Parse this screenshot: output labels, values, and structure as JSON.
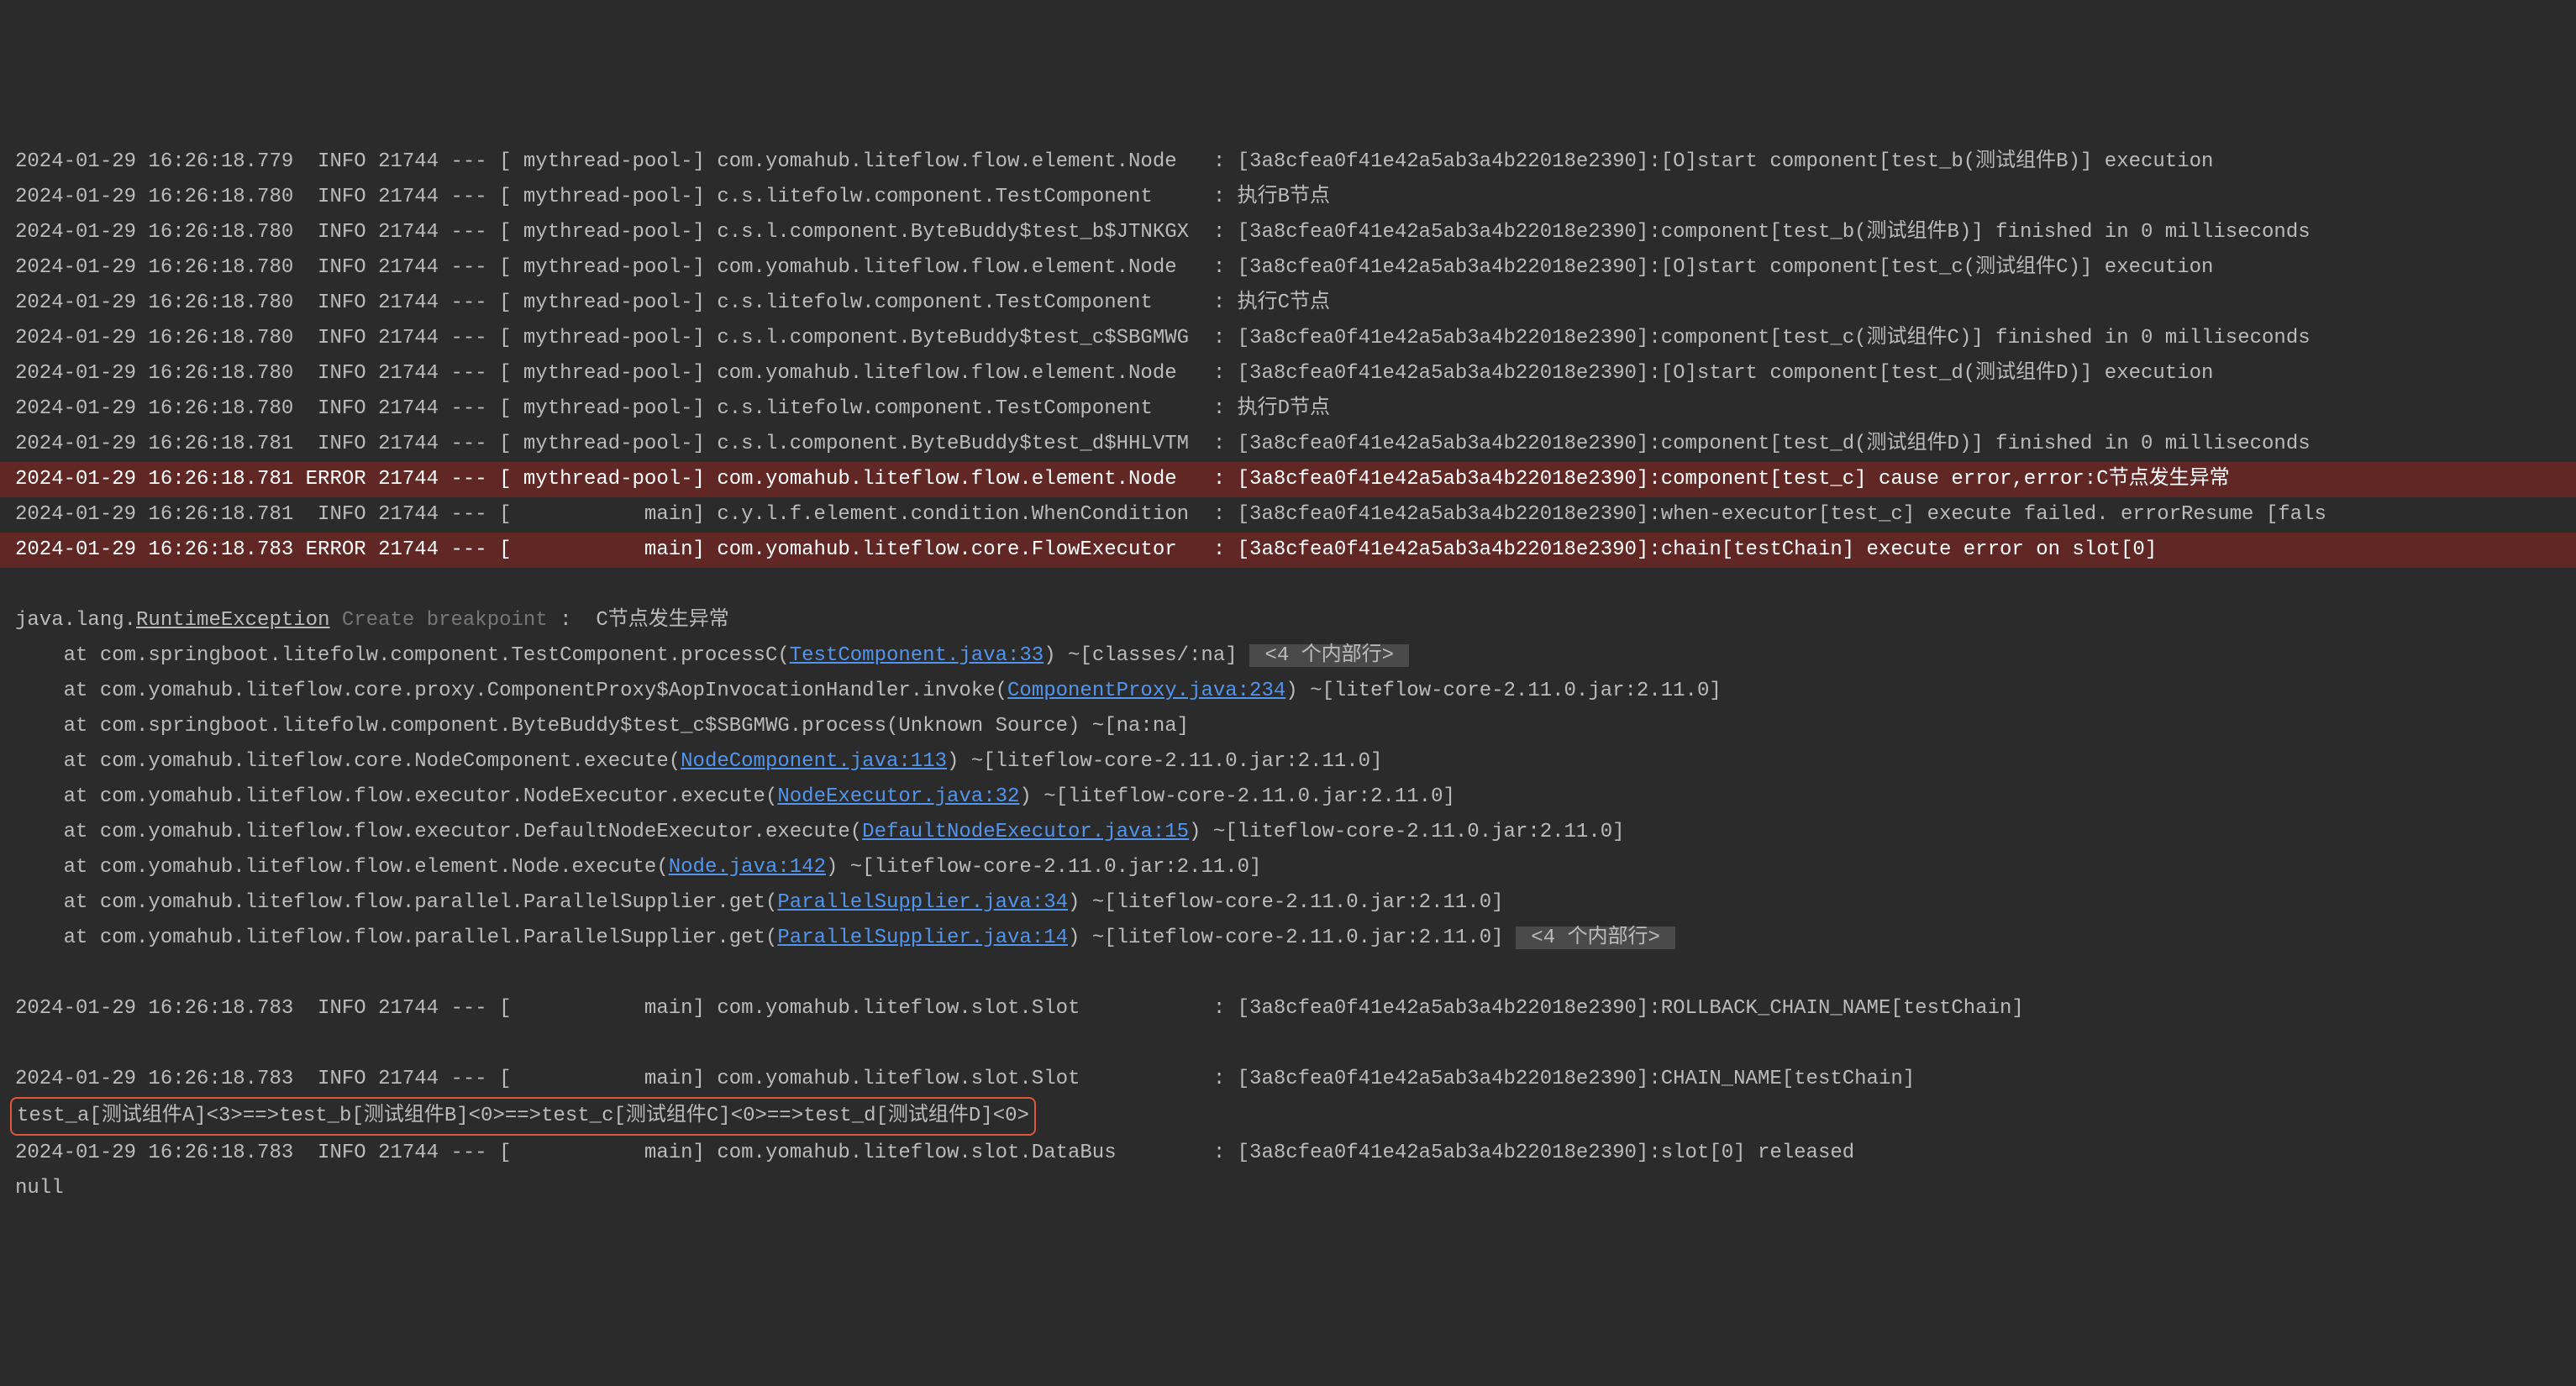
{
  "logLines": [
    {
      "type": "normal",
      "text": "2024-01-29 16:26:18.779  INFO 21744 --- [ mythread-pool-] com.yomahub.liteflow.flow.element.Node   : [3a8cfea0f41e42a5ab3a4b22018e2390]:[O]start component[test_b(测试组件B)] execution"
    },
    {
      "type": "normal",
      "text": "2024-01-29 16:26:18.780  INFO 21744 --- [ mythread-pool-] c.s.litefolw.component.TestComponent     : 执行B节点"
    },
    {
      "type": "normal",
      "text": "2024-01-29 16:26:18.780  INFO 21744 --- [ mythread-pool-] c.s.l.component.ByteBuddy$test_b$JTNKGX  : [3a8cfea0f41e42a5ab3a4b22018e2390]:component[test_b(测试组件B)] finished in 0 milliseconds"
    },
    {
      "type": "normal",
      "text": "2024-01-29 16:26:18.780  INFO 21744 --- [ mythread-pool-] com.yomahub.liteflow.flow.element.Node   : [3a8cfea0f41e42a5ab3a4b22018e2390]:[O]start component[test_c(测试组件C)] execution"
    },
    {
      "type": "normal",
      "text": "2024-01-29 16:26:18.780  INFO 21744 --- [ mythread-pool-] c.s.litefolw.component.TestComponent     : 执行C节点"
    },
    {
      "type": "normal",
      "text": "2024-01-29 16:26:18.780  INFO 21744 --- [ mythread-pool-] c.s.l.component.ByteBuddy$test_c$SBGMWG  : [3a8cfea0f41e42a5ab3a4b22018e2390]:component[test_c(测试组件C)] finished in 0 milliseconds"
    },
    {
      "type": "normal",
      "text": "2024-01-29 16:26:18.780  INFO 21744 --- [ mythread-pool-] com.yomahub.liteflow.flow.element.Node   : [3a8cfea0f41e42a5ab3a4b22018e2390]:[O]start component[test_d(测试组件D)] execution"
    },
    {
      "type": "normal",
      "text": "2024-01-29 16:26:18.780  INFO 21744 --- [ mythread-pool-] c.s.litefolw.component.TestComponent     : 执行D节点"
    },
    {
      "type": "normal",
      "text": "2024-01-29 16:26:18.781  INFO 21744 --- [ mythread-pool-] c.s.l.component.ByteBuddy$test_d$HHLVTM  : [3a8cfea0f41e42a5ab3a4b22018e2390]:component[test_d(测试组件D)] finished in 0 milliseconds"
    },
    {
      "type": "error",
      "text": "2024-01-29 16:26:18.781 ERROR 21744 --- [ mythread-pool-] com.yomahub.liteflow.flow.element.Node   : [3a8cfea0f41e42a5ab3a4b22018e2390]:component[test_c] cause error,error:C节点发生异常"
    },
    {
      "type": "normal",
      "text": "2024-01-29 16:26:18.781  INFO 21744 --- [           main] c.y.l.f.element.condition.WhenCondition  : [3a8cfea0f41e42a5ab3a4b22018e2390]:when-executor[test_c] execute failed. errorResume [fals"
    },
    {
      "type": "error",
      "text": "2024-01-29 16:26:18.783 ERROR 21744 --- [           main] com.yomahub.liteflow.core.FlowExecutor   : [3a8cfea0f41e42a5ab3a4b22018e2390]:chain[testChain] execute error on slot[0]"
    }
  ],
  "exception": {
    "prefix": "java.lang.",
    "type": "RuntimeException",
    "breakpoint": "Create breakpoint",
    "sep": " :  ",
    "message": "C节点发生异常"
  },
  "stack": [
    {
      "pre": "    at com.springboot.litefolw.component.TestComponent.processC(",
      "link": "TestComponent.java:33",
      "post": ") ~[classes/:na]",
      "badge": "<4 个内部行>"
    },
    {
      "pre": "    at com.yomahub.liteflow.core.proxy.ComponentProxy$AopInvocationHandler.invoke(",
      "link": "ComponentProxy.java:234",
      "post": ") ~[liteflow-core-2.11.0.jar:2.11.0]"
    },
    {
      "pre": "    at com.springboot.litefolw.component.ByteBuddy$test_c$SBGMWG.process(Unknown Source) ~[na:na]"
    },
    {
      "pre": "    at com.yomahub.liteflow.core.NodeComponent.execute(",
      "link": "NodeComponent.java:113",
      "post": ") ~[liteflow-core-2.11.0.jar:2.11.0]"
    },
    {
      "pre": "    at com.yomahub.liteflow.flow.executor.NodeExecutor.execute(",
      "link": "NodeExecutor.java:32",
      "post": ") ~[liteflow-core-2.11.0.jar:2.11.0]"
    },
    {
      "pre": "    at com.yomahub.liteflow.flow.executor.DefaultNodeExecutor.execute(",
      "link": "DefaultNodeExecutor.java:15",
      "post": ") ~[liteflow-core-2.11.0.jar:2.11.0]"
    },
    {
      "pre": "    at com.yomahub.liteflow.flow.element.Node.execute(",
      "link": "Node.java:142",
      "post": ") ~[liteflow-core-2.11.0.jar:2.11.0]"
    },
    {
      "pre": "    at com.yomahub.liteflow.flow.parallel.ParallelSupplier.get(",
      "link": "ParallelSupplier.java:34",
      "post": ") ~[liteflow-core-2.11.0.jar:2.11.0]"
    },
    {
      "pre": "    at com.yomahub.liteflow.flow.parallel.ParallelSupplier.get(",
      "link": "ParallelSupplier.java:14",
      "post": ") ~[liteflow-core-2.11.0.jar:2.11.0]",
      "badge": "<4 个内部行>"
    }
  ],
  "tailLines": [
    {
      "type": "normal",
      "text": "2024-01-29 16:26:18.783  INFO 21744 --- [           main] com.yomahub.liteflow.slot.Slot           : [3a8cfea0f41e42a5ab3a4b22018e2390]:ROLLBACK_CHAIN_NAME[testChain]"
    }
  ],
  "chainLog": {
    "header": "2024-01-29 16:26:18.783  INFO 21744 --- [           main] com.yomahub.liteflow.slot.Slot           : [3a8cfea0f41e42a5ab3a4b22018e2390]:CHAIN_NAME[testChain]",
    "chain": "test_a[测试组件A]<3>==>test_b[测试组件B]<0>==>test_c[测试组件C]<0>==>test_d[测试组件D]<0>"
  },
  "afterChain": [
    {
      "type": "normal",
      "text": "2024-01-29 16:26:18.783  INFO 21744 --- [           main] com.yomahub.liteflow.slot.DataBus        : [3a8cfea0f41e42a5ab3a4b22018e2390]:slot[0] released"
    },
    {
      "type": "normal",
      "text": "null"
    }
  ]
}
